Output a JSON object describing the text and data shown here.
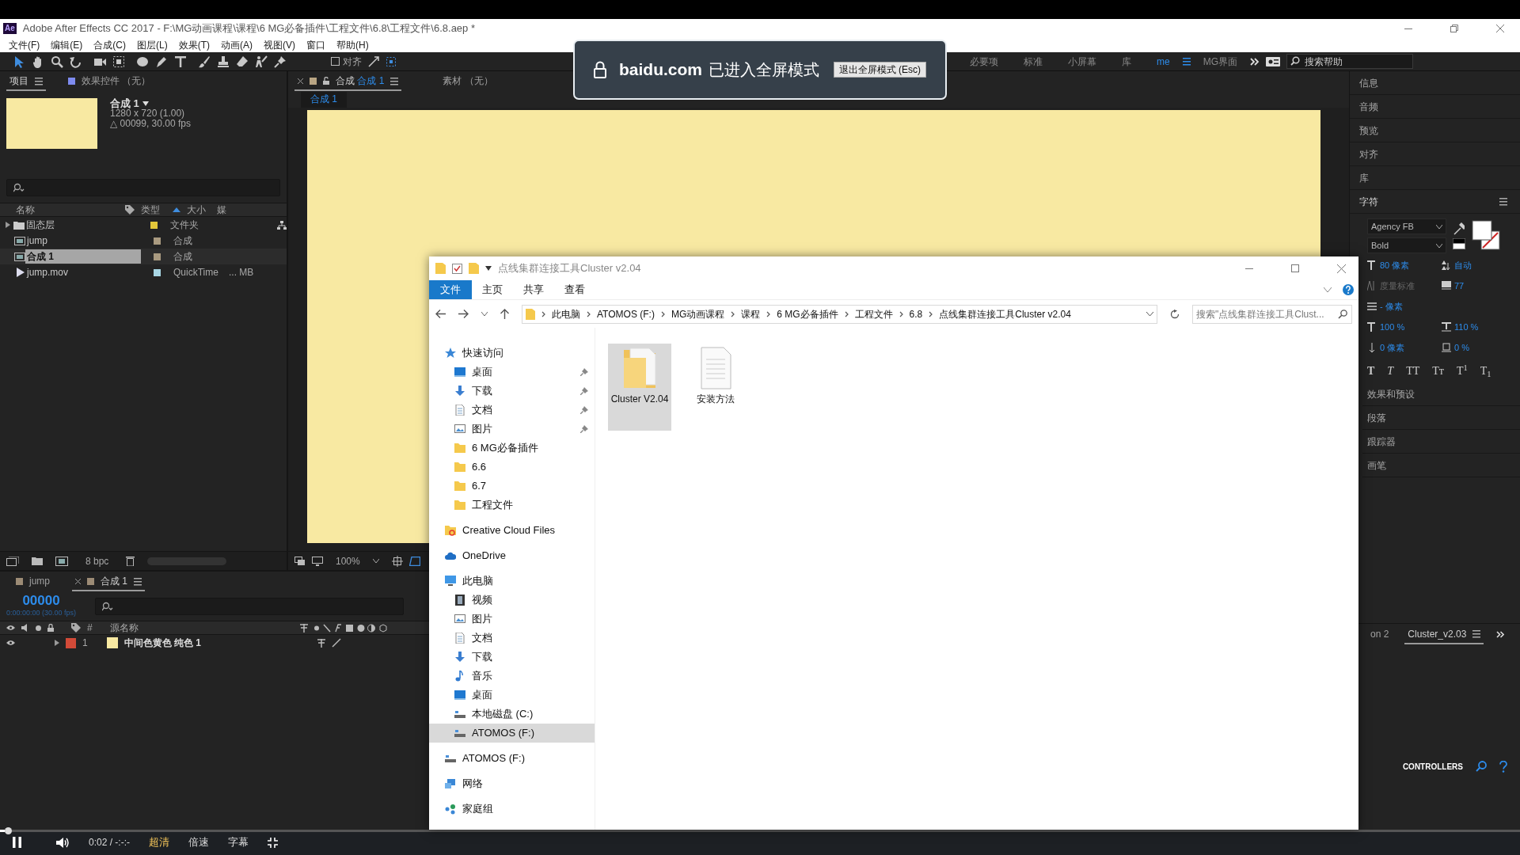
{
  "window": {
    "title": "Adobe After Effects CC 2017 - F:\\MG动画课程\\课程\\6 MG必备插件\\工程文件\\6.8\\工程文件\\6.8.aep *",
    "app_badge": "Ae"
  },
  "menu": [
    "文件(F)",
    "编辑(E)",
    "合成(C)",
    "图层(L)",
    "效果(T)",
    "动画(A)",
    "视图(V)",
    "窗口",
    "帮助(H)"
  ],
  "toolbar": {
    "align_label": "对齐",
    "align_checked": false,
    "workspaces": [
      {
        "label": "必要项",
        "selected": false
      },
      {
        "label": "标准",
        "selected": false
      },
      {
        "label": "小屏幕",
        "selected": false
      },
      {
        "label": "库",
        "selected": false
      },
      {
        "label": "me",
        "selected": true
      },
      {
        "label": "MG界面",
        "selected": false
      }
    ],
    "search_placeholder": "搜索帮助"
  },
  "project_panel": {
    "tabs": [
      {
        "label": "项目",
        "selected": true
      },
      {
        "label": "效果控件 （无）",
        "selected": false
      }
    ],
    "comp_name": "合成 1",
    "comp_size": "1280 x 720 (1.00)",
    "comp_duration": "△ 00099, 30.00 fps",
    "columns": [
      "名称",
      "类型",
      "大小",
      "媒"
    ],
    "items": [
      {
        "kind": "folder",
        "name": "固态层",
        "type": "文件夹",
        "color": "#e3c73a",
        "selected": false
      },
      {
        "kind": "comp",
        "name": "jump",
        "type": "合成",
        "color": "#a99a80",
        "selected": false
      },
      {
        "kind": "comp",
        "name": "合成 1",
        "type": "合成",
        "color": "#a99a80",
        "selected": true
      },
      {
        "kind": "movie",
        "name": "jump.mov",
        "type": "QuickTime",
        "size": "... MB",
        "color": "#a8d6e4",
        "selected": false
      }
    ],
    "bpc": "8 bpc"
  },
  "viewer": {
    "tabs": [
      {
        "prefix": "合成",
        "label": "合成 1",
        "selected": true
      },
      {
        "prefix": "素材",
        "label": "（无）",
        "selected": false
      }
    ],
    "sub_tab": "合成 1",
    "zoom": "100%"
  },
  "timeline": {
    "tabs": [
      {
        "label": "jump",
        "selected": false
      },
      {
        "label": "合成 1",
        "selected": true
      }
    ],
    "timecode": "00000",
    "timecode_detail": "0:00:00:00 (30.00 fps)",
    "columns": [
      "#",
      "源名称"
    ],
    "layers": [
      {
        "number": "1",
        "name": "中间色黄色 纯色 1",
        "color": "#d24a38"
      }
    ]
  },
  "right_panel": {
    "panels_top": [
      "信息",
      "音频",
      "预览",
      "对齐",
      "库"
    ],
    "character": {
      "title": "字符",
      "font": "Agency FB",
      "style": "Bold",
      "size": "80",
      "size_unit": "像素",
      "leading": "自动",
      "kerning": "度量标准",
      "tracking": "77",
      "stroke": "-",
      "stroke_unit": "像素",
      "vscale": "100",
      "vscale_unit": "%",
      "hscale": "110",
      "hscale_unit": "%",
      "baseline": "0",
      "baseline_unit": "像素",
      "tsume": "0",
      "tsume_unit": "%",
      "styles": [
        "T",
        "T",
        "TT",
        "Tт",
        "T$^{1}$",
        "T$_{1}$"
      ]
    },
    "panels_bottom": [
      "效果和预设",
      "段落",
      "跟踪器",
      "画笔"
    ],
    "lower_tabs": [
      {
        "label": "on 2",
        "selected": false
      },
      {
        "label": "Cluster_v2.03",
        "selected": true
      }
    ],
    "controllers": "CONTROLLERS"
  },
  "explorer": {
    "title": "点线集群连接工具Cluster v2.04",
    "ribbon_tabs": [
      {
        "label": "文件",
        "selected": true
      },
      {
        "label": "主页",
        "selected": false
      },
      {
        "label": "共享",
        "selected": false
      },
      {
        "label": "查看",
        "selected": false
      }
    ],
    "breadcrumb": [
      "此电脑",
      "ATOMOS (F:)",
      "MG动画课程",
      "课程",
      "6 MG必备插件",
      "工程文件",
      "6.8",
      "点线集群连接工具Cluster v2.04"
    ],
    "search_placeholder": "搜索\"点线集群连接工具Clust...",
    "nav": [
      {
        "label": "快速访问",
        "kind": "star",
        "selected": false,
        "children": [
          {
            "label": "桌面",
            "kind": "desktop",
            "pinned": true,
            "selected": false
          },
          {
            "label": "下载",
            "kind": "download",
            "pinned": true,
            "selected": false
          },
          {
            "label": "文档",
            "kind": "document",
            "pinned": true,
            "selected": false
          },
          {
            "label": "图片",
            "kind": "picture",
            "pinned": true,
            "selected": false
          },
          {
            "label": "6 MG必备插件",
            "kind": "folder",
            "pinned": false,
            "selected": false
          },
          {
            "label": "6.6",
            "kind": "folder",
            "pinned": false,
            "selected": false
          },
          {
            "label": "6.7",
            "kind": "folder",
            "pinned": false,
            "selected": false
          },
          {
            "label": "工程文件",
            "kind": "folder",
            "pinned": false,
            "selected": false
          }
        ]
      },
      {
        "label": "Creative Cloud Files",
        "kind": "ccfiles",
        "selected": false
      },
      {
        "label": "OneDrive",
        "kind": "cloud",
        "selected": false
      },
      {
        "label": "此电脑",
        "kind": "pc",
        "selected": false,
        "children": [
          {
            "label": "视频",
            "kind": "video",
            "selected": false
          },
          {
            "label": "图片",
            "kind": "picture",
            "selected": false
          },
          {
            "label": "文档",
            "kind": "document",
            "selected": false
          },
          {
            "label": "下载",
            "kind": "download",
            "selected": false
          },
          {
            "label": "音乐",
            "kind": "music",
            "selected": false
          },
          {
            "label": "桌面",
            "kind": "desktop",
            "selected": false
          },
          {
            "label": "本地磁盘 (C:)",
            "kind": "drive",
            "selected": false
          },
          {
            "label": "ATOMOS (F:)",
            "kind": "drive",
            "selected": true
          }
        ]
      },
      {
        "label": "ATOMOS (F:)",
        "kind": "drive",
        "selected": false
      },
      {
        "label": "网络",
        "kind": "network",
        "selected": false
      },
      {
        "label": "家庭组",
        "kind": "homegroup",
        "selected": false
      }
    ],
    "files": [
      {
        "name": "Cluster V2.04",
        "kind": "folder",
        "selected": true
      },
      {
        "name": "安装方法",
        "kind": "document",
        "selected": false
      }
    ]
  },
  "fullscreen_banner": {
    "site": "baidu.com",
    "message": "已进入全屏模式",
    "button": "退出全屏模式 (Esc)"
  },
  "player": {
    "progress": {
      "level": 0.003
    },
    "time": "0:02 / -:-:-",
    "options": [
      {
        "label": "超清",
        "selected": true
      },
      {
        "label": "倍速",
        "selected": false
      },
      {
        "label": "字幕",
        "selected": false
      }
    ]
  }
}
